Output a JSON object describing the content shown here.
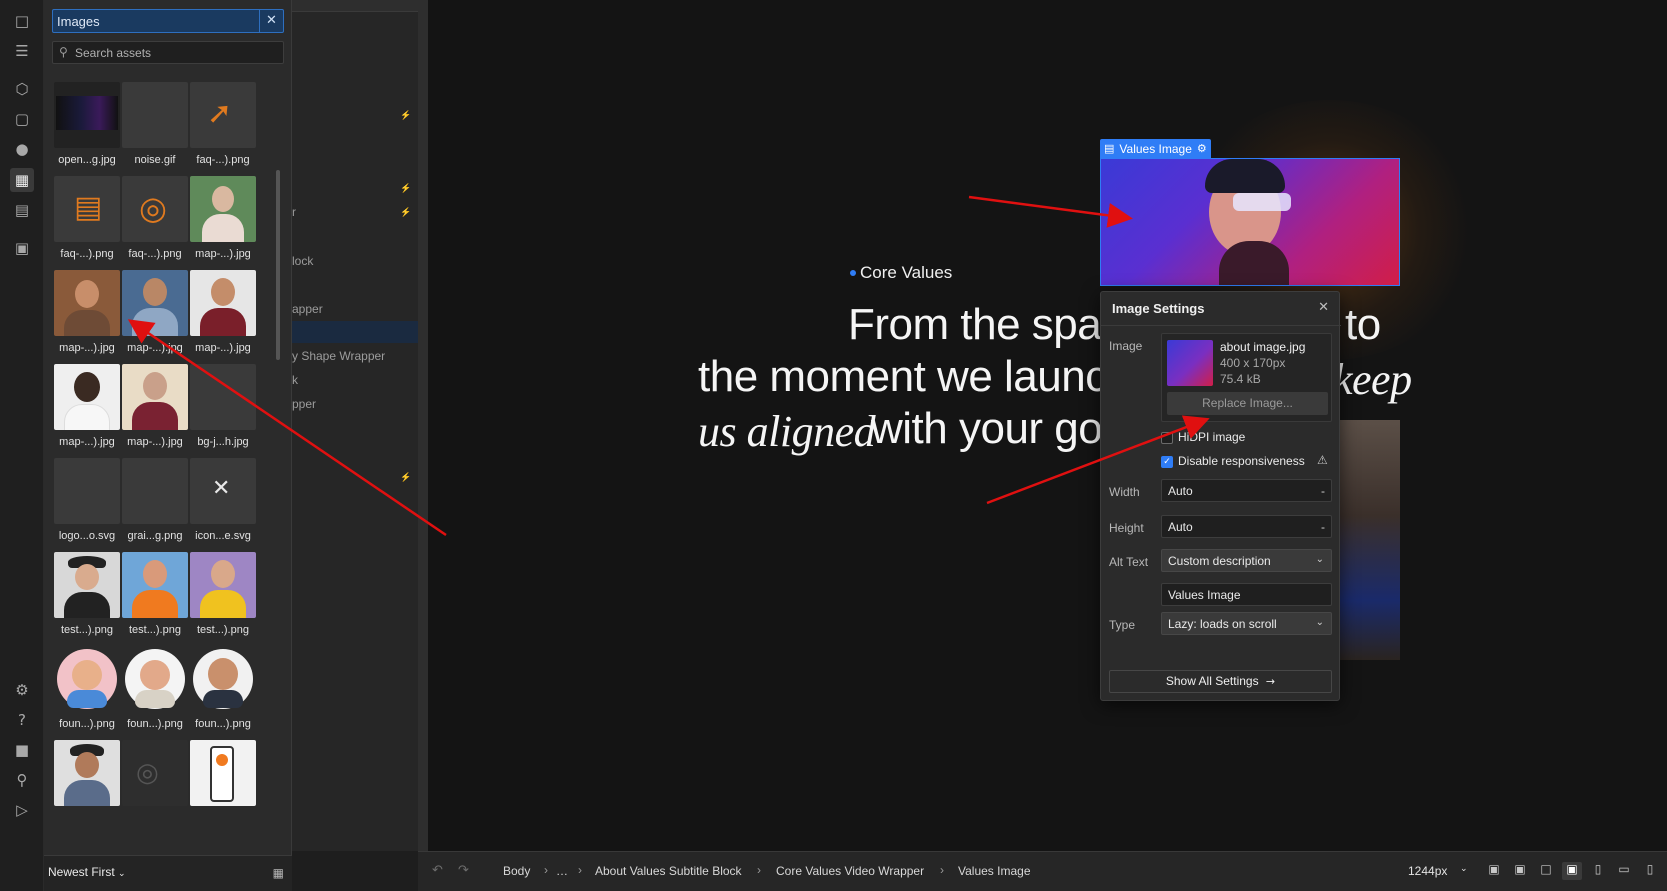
{
  "rail_icons": [
    "pages-icon",
    "navigator-icon",
    "components-icon",
    "styles-icon",
    "variables-icon",
    "assets-icon",
    "cms-icon",
    "apps-icon",
    "settings-icon",
    "help-icon",
    "stop-icon",
    "search-icon",
    "video-icon"
  ],
  "assets": {
    "title": "Images",
    "search_placeholder": "Search assets",
    "sort_label": "Newest First",
    "items": [
      "open...g.jpg",
      "noise.gif",
      "faq-...).png",
      "faq-...).png",
      "faq-...).png",
      "map-...).jpg",
      "map-...).jpg",
      "map-...).jpg",
      "map-...).jpg",
      "map-...).jpg",
      "map-...).jpg",
      "bg-j...h.jpg",
      "logo...o.svg",
      "grai...g.png",
      "icon...e.svg",
      "test...).png",
      "test...).png",
      "test...).png",
      "foun...).png",
      "foun...).png",
      "foun...).png"
    ]
  },
  "navigator": {
    "rows": [
      "lock",
      "r",
      "apper",
      "y Shape Wrapper",
      "k",
      "pper"
    ]
  },
  "canvas": {
    "eyebrow": "Core Values",
    "headline_line1": "From the spa",
    "headline_line1_end": "to",
    "headline_line2": "the moment we launc",
    "headline_line2_italic": "keep",
    "headline_line3_italic": "us aligned",
    "headline_line3": "with your go",
    "selected_tag": "Values Image",
    "accent_color": "#2f7df6"
  },
  "image_settings": {
    "title": "Image Settings",
    "image_label": "Image",
    "file_name": "about image.jpg",
    "dimensions": "400 x 170px",
    "file_size": "75.4 kB",
    "replace_label": "Replace Image...",
    "hidpi_label": "HiDPI image",
    "hidpi_checked": false,
    "disable_resp_label": "Disable responsiveness",
    "disable_resp_checked": true,
    "width_label": "Width",
    "width_value": "Auto",
    "height_label": "Height",
    "height_value": "Auto",
    "dash": "-",
    "alt_label": "Alt Text",
    "alt_mode": "Custom description",
    "alt_value": "Values Image",
    "type_label": "Type",
    "type_value": "Lazy: loads on scroll",
    "show_all_label": "Show All Settings",
    "arrow_glyph": "→"
  },
  "bottom_bar": {
    "crumbs": [
      "Body",
      "…",
      "About Values Subtitle Block",
      "Core Values Video Wrapper",
      "Values Image"
    ],
    "breakpoint": "1244px"
  }
}
